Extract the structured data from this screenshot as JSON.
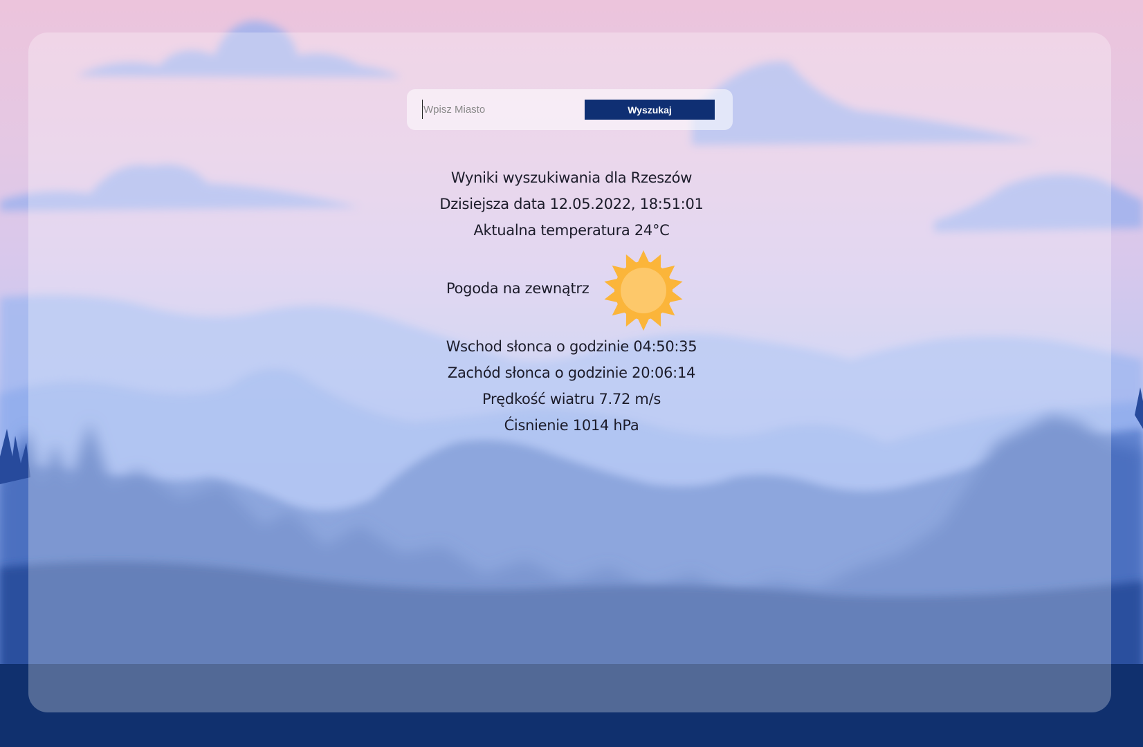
{
  "search": {
    "placeholder": "Wpisz Miasto",
    "button_label": "Wyszukaj"
  },
  "results": {
    "heading": "Wyniki wyszukiwania dla Rzeszów",
    "date": "Dzisiejsza data 12.05.2022, 18:51:01",
    "temperature": "Aktualna temperatura 24°C",
    "weather_label": "Pogoda na zewnątrz",
    "weather_icon": "sun-icon",
    "sunrise": "Wschod słonca o godzinie 04:50:35",
    "sunset": "Zachód słonca o godzinie 20:06:14",
    "wind": "Prędkość wiatru 7.72 m/s",
    "pressure": "Ćisnienie 1014 hPa"
  },
  "colors": {
    "button_bg": "#0f2f73",
    "sun_outer": "#fbb53a",
    "sun_inner": "#fdc86a"
  }
}
